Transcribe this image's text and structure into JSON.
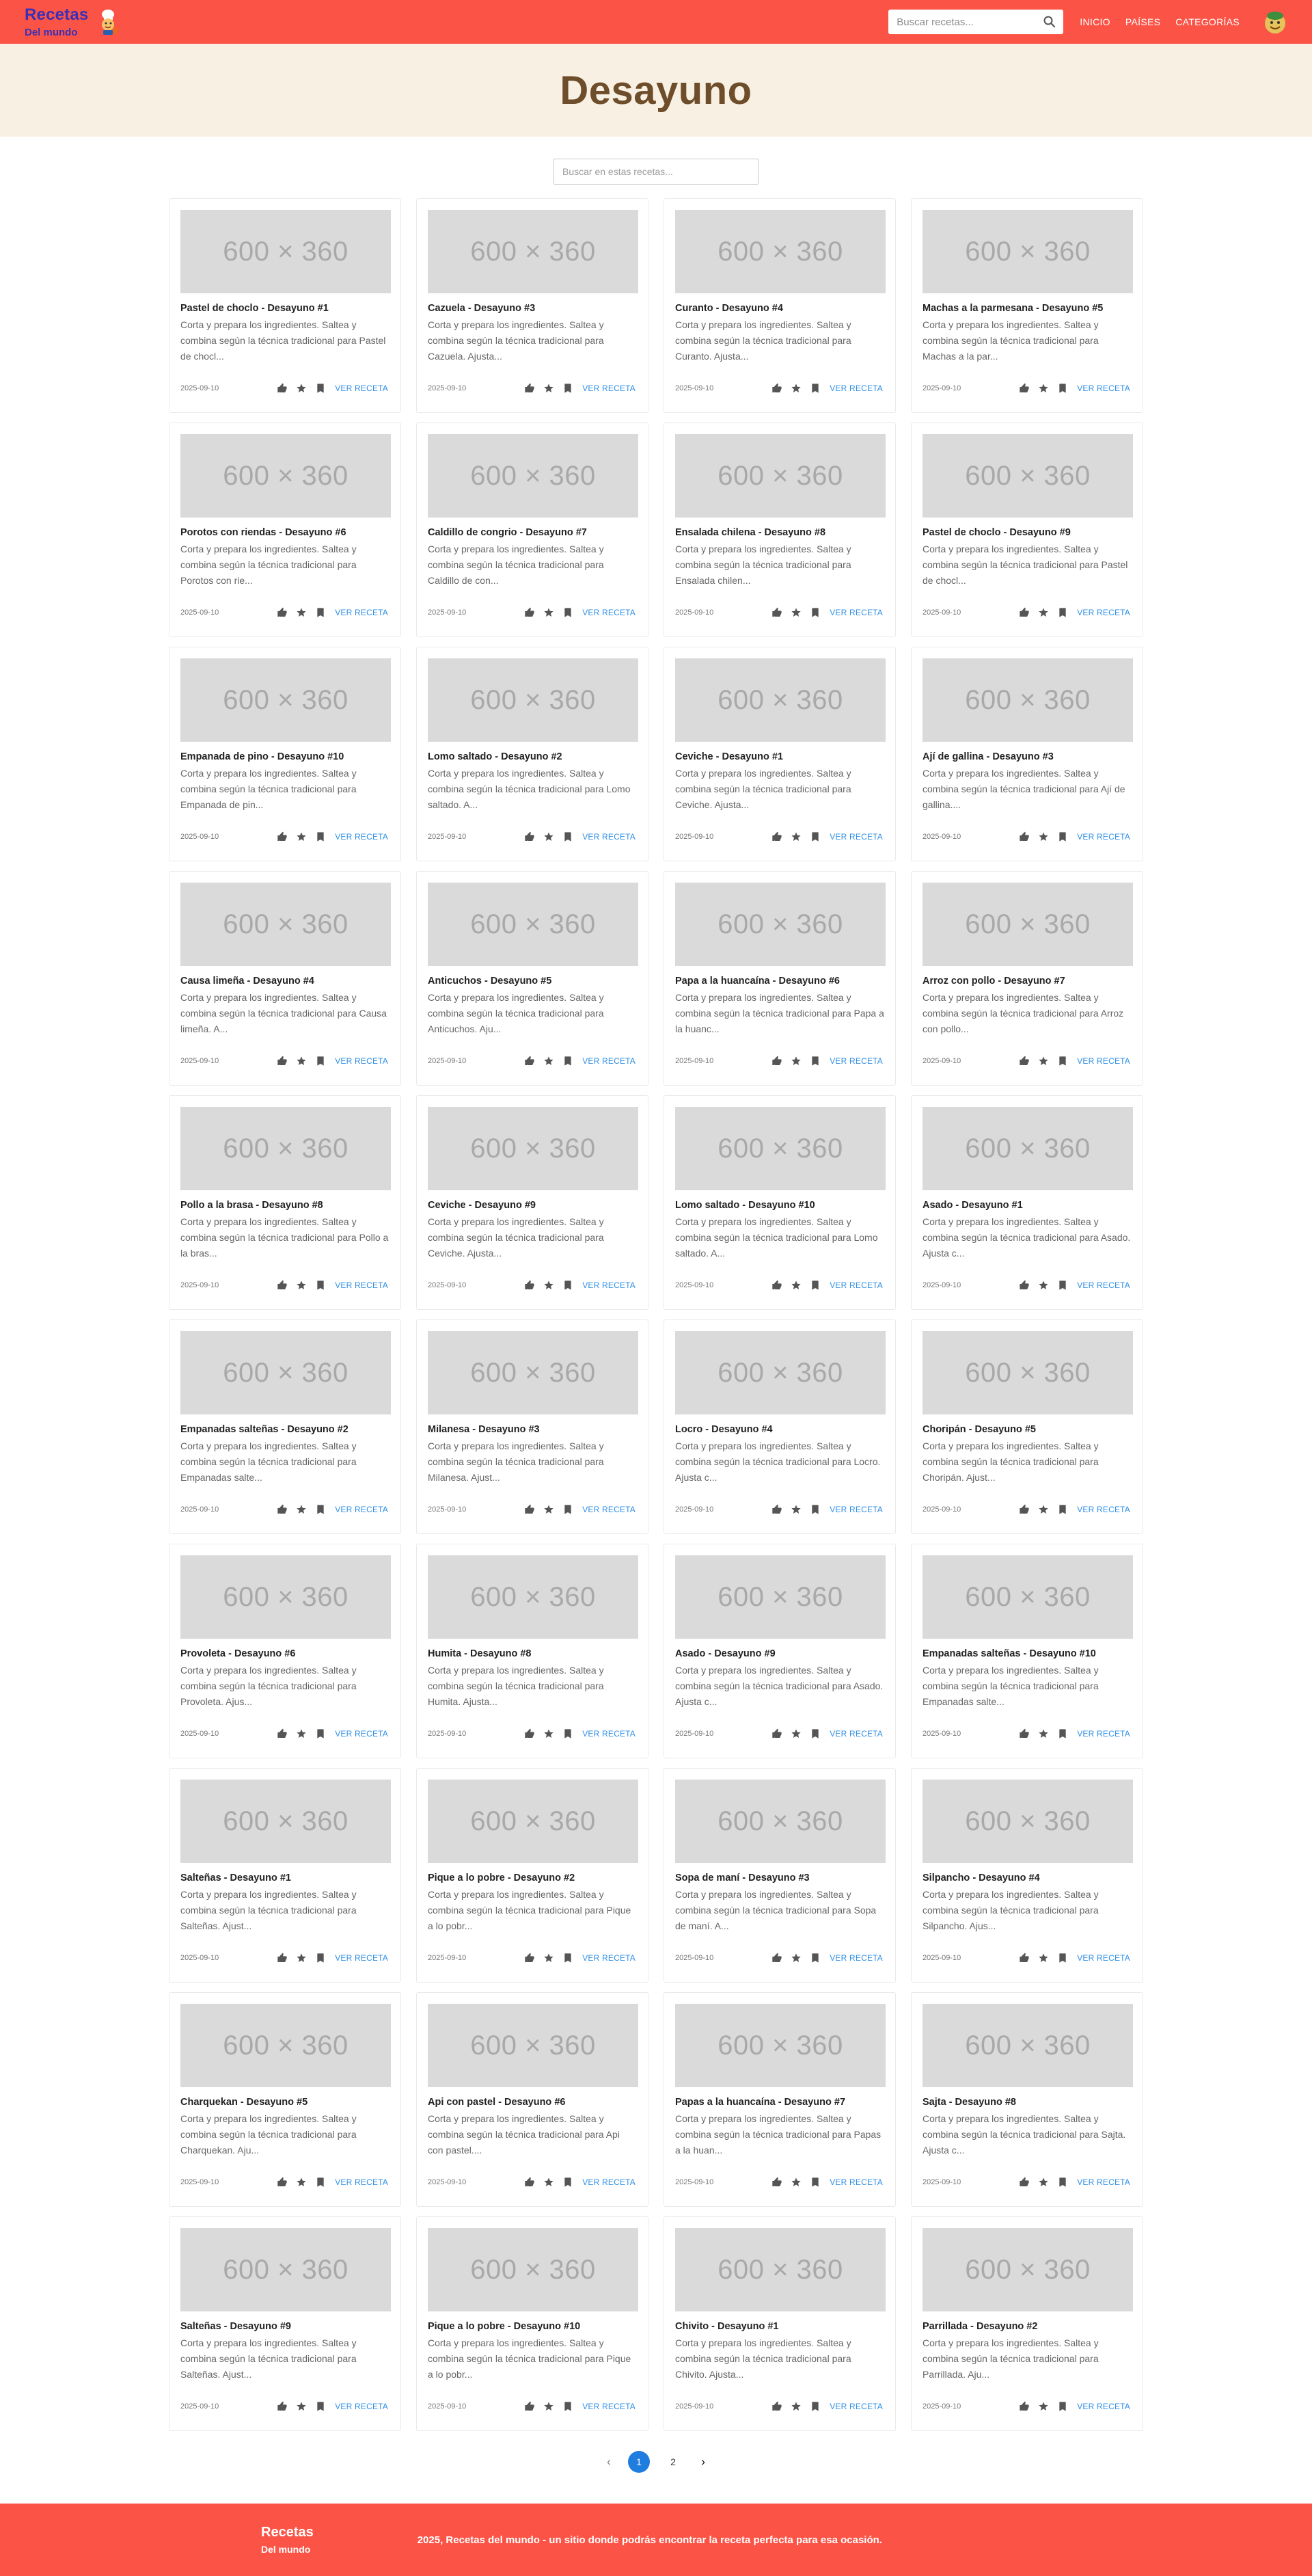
{
  "header": {
    "logo_title": "Recetas",
    "logo_subtitle": "Del mundo",
    "search_placeholder": "Buscar recetas...",
    "nav": [
      "INICIO",
      "PAÍSES",
      "CATEGORÍAS"
    ]
  },
  "hero": {
    "title": "Desayuno"
  },
  "filter": {
    "placeholder": "Buscar en estas recetas..."
  },
  "common": {
    "image_label": "600 × 360",
    "date": "2025-09-10",
    "cta": "VER RECETA"
  },
  "recipes": [
    {
      "title": "Pastel de choclo - Desayuno #1",
      "desc": "Corta y prepara los ingredientes. Saltea y combina según la técnica tradicional para Pastel de chocl..."
    },
    {
      "title": "Cazuela - Desayuno #3",
      "desc": "Corta y prepara los ingredientes. Saltea y combina según la técnica tradicional para Cazuela. Ajusta..."
    },
    {
      "title": "Curanto - Desayuno #4",
      "desc": "Corta y prepara los ingredientes. Saltea y combina según la técnica tradicional para Curanto. Ajusta..."
    },
    {
      "title": "Machas a la parmesana - Desayuno #5",
      "desc": "Corta y prepara los ingredientes. Saltea y combina según la técnica tradicional para Machas a la par..."
    },
    {
      "title": "Porotos con riendas - Desayuno #6",
      "desc": "Corta y prepara los ingredientes. Saltea y combina según la técnica tradicional para Porotos con rie..."
    },
    {
      "title": "Caldillo de congrio - Desayuno #7",
      "desc": "Corta y prepara los ingredientes. Saltea y combina según la técnica tradicional para Caldillo de con..."
    },
    {
      "title": "Ensalada chilena - Desayuno #8",
      "desc": "Corta y prepara los ingredientes. Saltea y combina según la técnica tradicional para Ensalada chilen..."
    },
    {
      "title": "Pastel de choclo - Desayuno #9",
      "desc": "Corta y prepara los ingredientes. Saltea y combina según la técnica tradicional para Pastel de chocl..."
    },
    {
      "title": "Empanada de pino - Desayuno #10",
      "desc": "Corta y prepara los ingredientes. Saltea y combina según la técnica tradicional para Empanada de pin..."
    },
    {
      "title": "Lomo saltado - Desayuno #2",
      "desc": "Corta y prepara los ingredientes. Saltea y combina según la técnica tradicional para Lomo saltado. A..."
    },
    {
      "title": "Ceviche - Desayuno #1",
      "desc": "Corta y prepara los ingredientes. Saltea y combina según la técnica tradicional para Ceviche. Ajusta..."
    },
    {
      "title": "Ají de gallina - Desayuno #3",
      "desc": "Corta y prepara los ingredientes. Saltea y combina según la técnica tradicional para Ají de gallina...."
    },
    {
      "title": "Causa limeña - Desayuno #4",
      "desc": "Corta y prepara los ingredientes. Saltea y combina según la técnica tradicional para Causa limeña. A..."
    },
    {
      "title": "Anticuchos - Desayuno #5",
      "desc": "Corta y prepara los ingredientes. Saltea y combina según la técnica tradicional para Anticuchos. Aju..."
    },
    {
      "title": "Papa a la huancaína - Desayuno #6",
      "desc": "Corta y prepara los ingredientes. Saltea y combina según la técnica tradicional para Papa a la huanc..."
    },
    {
      "title": "Arroz con pollo - Desayuno #7",
      "desc": "Corta y prepara los ingredientes. Saltea y combina según la técnica tradicional para Arroz con pollo..."
    },
    {
      "title": "Pollo a la brasa - Desayuno #8",
      "desc": "Corta y prepara los ingredientes. Saltea y combina según la técnica tradicional para Pollo a la bras..."
    },
    {
      "title": "Ceviche - Desayuno #9",
      "desc": "Corta y prepara los ingredientes. Saltea y combina según la técnica tradicional para Ceviche. Ajusta..."
    },
    {
      "title": "Lomo saltado - Desayuno #10",
      "desc": "Corta y prepara los ingredientes. Saltea y combina según la técnica tradicional para Lomo saltado. A..."
    },
    {
      "title": "Asado - Desayuno #1",
      "desc": "Corta y prepara los ingredientes. Saltea y combina según la técnica tradicional para Asado. Ajusta c..."
    },
    {
      "title": "Empanadas salteñas - Desayuno #2",
      "desc": "Corta y prepara los ingredientes. Saltea y combina según la técnica tradicional para Empanadas salte..."
    },
    {
      "title": "Milanesa - Desayuno #3",
      "desc": "Corta y prepara los ingredientes. Saltea y combina según la técnica tradicional para Milanesa. Ajust..."
    },
    {
      "title": "Locro - Desayuno #4",
      "desc": "Corta y prepara los ingredientes. Saltea y combina según la técnica tradicional para Locro. Ajusta c..."
    },
    {
      "title": "Choripán - Desayuno #5",
      "desc": "Corta y prepara los ingredientes. Saltea y combina según la técnica tradicional para Choripán. Ajust..."
    },
    {
      "title": "Provoleta - Desayuno #6",
      "desc": "Corta y prepara los ingredientes. Saltea y combina según la técnica tradicional para Provoleta. Ajus..."
    },
    {
      "title": "Humita - Desayuno #8",
      "desc": "Corta y prepara los ingredientes. Saltea y combina según la técnica tradicional para Humita. Ajusta..."
    },
    {
      "title": "Asado - Desayuno #9",
      "desc": "Corta y prepara los ingredientes. Saltea y combina según la técnica tradicional para Asado. Ajusta c..."
    },
    {
      "title": "Empanadas salteñas - Desayuno #10",
      "desc": "Corta y prepara los ingredientes. Saltea y combina según la técnica tradicional para Empanadas salte..."
    },
    {
      "title": "Salteñas - Desayuno #1",
      "desc": "Corta y prepara los ingredientes. Saltea y combina según la técnica tradicional para Salteñas. Ajust..."
    },
    {
      "title": "Pique a lo pobre - Desayuno #2",
      "desc": "Corta y prepara los ingredientes. Saltea y combina según la técnica tradicional para Pique a lo pobr..."
    },
    {
      "title": "Sopa de maní - Desayuno #3",
      "desc": "Corta y prepara los ingredientes. Saltea y combina según la técnica tradicional para Sopa de maní. A..."
    },
    {
      "title": "Silpancho - Desayuno #4",
      "desc": "Corta y prepara los ingredientes. Saltea y combina según la técnica tradicional para Silpancho. Ajus..."
    },
    {
      "title": "Charquekan - Desayuno #5",
      "desc": "Corta y prepara los ingredientes. Saltea y combina según la técnica tradicional para Charquekan. Aju..."
    },
    {
      "title": "Api con pastel - Desayuno #6",
      "desc": "Corta y prepara los ingredientes. Saltea y combina según la técnica tradicional para Api con pastel...."
    },
    {
      "title": "Papas a la huancaína - Desayuno #7",
      "desc": "Corta y prepara los ingredientes. Saltea y combina según la técnica tradicional para Papas a la huan..."
    },
    {
      "title": "Sajta - Desayuno #8",
      "desc": "Corta y prepara los ingredientes. Saltea y combina según la técnica tradicional para Sajta. Ajusta c..."
    },
    {
      "title": "Salteñas - Desayuno #9",
      "desc": "Corta y prepara los ingredientes. Saltea y combina según la técnica tradicional para Salteñas. Ajust..."
    },
    {
      "title": "Pique a lo pobre - Desayuno #10",
      "desc": "Corta y prepara los ingredientes. Saltea y combina según la técnica tradicional para Pique a lo pobr..."
    },
    {
      "title": "Chivito - Desayuno #1",
      "desc": "Corta y prepara los ingredientes. Saltea y combina según la técnica tradicional para Chivito. Ajusta..."
    },
    {
      "title": "Parrillada - Desayuno #2",
      "desc": "Corta y prepara los ingredientes. Saltea y combina según la técnica tradicional para Parrillada. Aju..."
    }
  ],
  "pagination": {
    "prev": "‹",
    "next": "›",
    "pages": [
      "1",
      "2"
    ],
    "current": "1"
  },
  "footer": {
    "title": "Recetas",
    "subtitle": "Del mundo",
    "text": "2025, Recetas del mundo - un sitio donde podrás encontrar la receta perfecta para esa ocasión."
  },
  "colors": {
    "brand": "#fb5447",
    "logo": "#3b2fb5",
    "hero_bg": "#f8f1e3",
    "hero_text": "#6e4d2b",
    "link": "#2f8fe6",
    "active_page": "#1f7de0"
  }
}
